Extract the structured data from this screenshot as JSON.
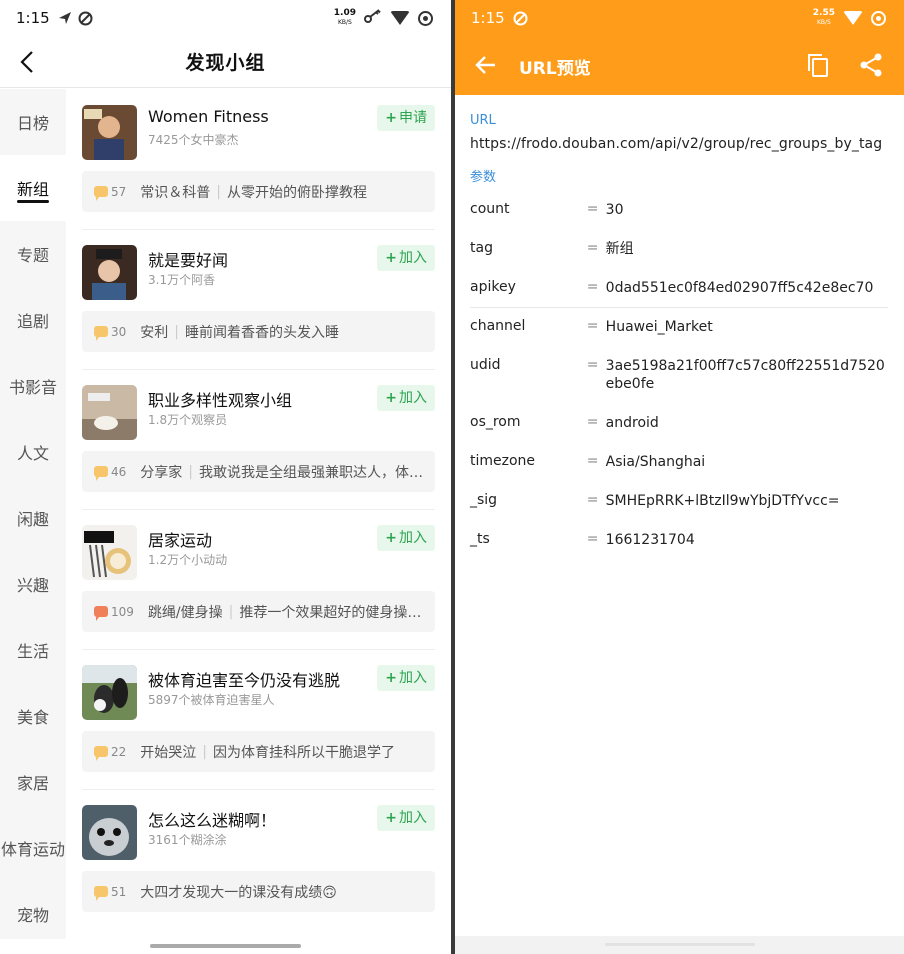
{
  "left": {
    "status": {
      "time": "1:15",
      "net_rate": "1.09",
      "net_unit": "KB/S"
    },
    "header": {
      "title": "发现小组"
    },
    "sidebar": {
      "items": [
        "日榜",
        "新组",
        "专题",
        "追剧",
        "书影音",
        "人文",
        "闲趣",
        "兴趣",
        "生活",
        "美食",
        "家居",
        "体育运动",
        "宠物"
      ],
      "active_index": 1
    },
    "groups": [
      {
        "name": "Women Fitness",
        "members": "7425个女中豪杰",
        "button": "申请",
        "topic_count": "57",
        "topic_tag": "常识＆科普",
        "topic_text": "从零开始的俯卧撑教程",
        "bubble_color": "#f8c66a"
      },
      {
        "name": "就是要好闻",
        "members": "3.1万个阿香",
        "button": "加入",
        "topic_count": "30",
        "topic_tag": "安利",
        "topic_text": "睡前闻着香香的头发入睡",
        "bubble_color": "#f8c66a"
      },
      {
        "name": "职业多样性观察小组",
        "members": "1.8万个观察员",
        "button": "加入",
        "topic_count": "46",
        "topic_tag": "分享家",
        "topic_text": "我敢说我是全组最强兼职达人，体…",
        "bubble_color": "#f8c66a"
      },
      {
        "name": "居家运动",
        "members": "1.2万个小动动",
        "button": "加入",
        "topic_count": "109",
        "topic_tag": "跳绳/健身操",
        "topic_text": "推荐一个效果超好的健身操…",
        "bubble_color": "#f0805a"
      },
      {
        "name": "被体育迫害至今仍没有逃脱",
        "members": "5897个被体育迫害星人",
        "button": "加入",
        "topic_count": "22",
        "topic_tag": "开始哭泣",
        "topic_text": "因为体育挂科所以干脆退学了",
        "bubble_color": "#f8c66a"
      },
      {
        "name": "怎么这么迷糊啊！",
        "members": "3161个糊涂涂",
        "button": "加入",
        "topic_count": "51",
        "topic_tag": "",
        "topic_text": "大四才发现大一的课没有成绩🙃",
        "bubble_color": "#f8c66a"
      }
    ]
  },
  "right": {
    "status": {
      "time": "1:15",
      "net_rate": "2.55",
      "net_unit": "KB/S"
    },
    "header": {
      "title": "URL预览"
    },
    "url_label": "URL",
    "url": "https://frodo.douban.com/api/v2/group/rec_groups_by_tag",
    "params_label": "参数",
    "params": [
      {
        "key": "count",
        "eq": "=",
        "value": "30"
      },
      {
        "key": "tag",
        "eq": "=",
        "value": "新组"
      },
      {
        "key": "apikey",
        "eq": "=",
        "value": "0dad551ec0f84ed02907ff5c42e8ec70"
      },
      {
        "key": "channel",
        "eq": "=",
        "value": "Huawei_Market"
      },
      {
        "key": "udid",
        "eq": "=",
        "value": "3ae5198a21f00ff7c57c80ff22551d7520ebe0fe"
      },
      {
        "key": "os_rom",
        "eq": "=",
        "value": "android"
      },
      {
        "key": "timezone",
        "eq": "=",
        "value": "Asia/Shanghai"
      },
      {
        "key": "_sig",
        "eq": "=",
        "value": "SMHEpRRK+lBtzIl9wYbjDTfYvcc="
      },
      {
        "key": "_ts",
        "eq": "=",
        "value": "1661231704"
      }
    ],
    "accent_color": "#ff9d1a",
    "label_color": "#3b8fd9"
  }
}
